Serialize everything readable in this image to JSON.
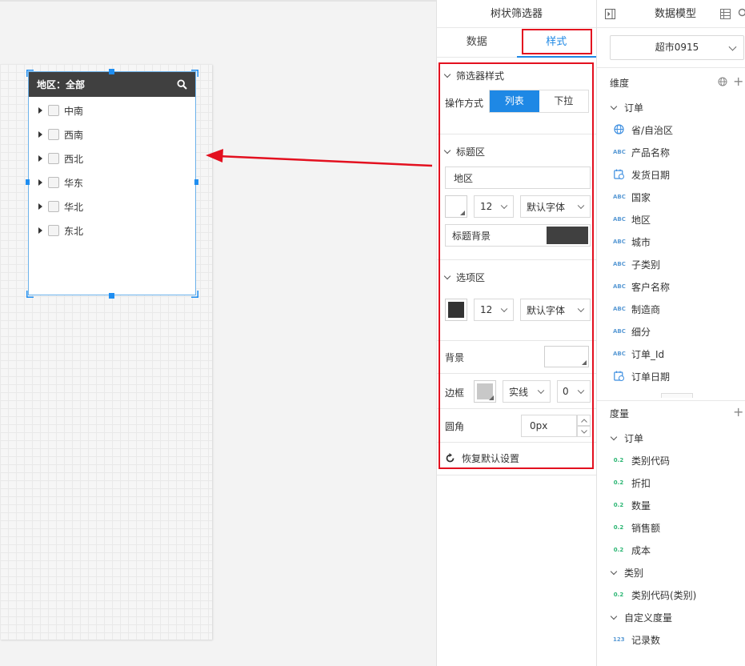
{
  "widget": {
    "title": "地区：全部",
    "items": [
      "中南",
      "西南",
      "西北",
      "华东",
      "华北",
      "东北"
    ]
  },
  "filter_panel": {
    "title": "树状筛选器",
    "tabs": [
      "数据",
      "样式"
    ],
    "active_tab": "样式",
    "section_filter_style": "筛选器样式",
    "operation_label": "操作方式",
    "operation_options": [
      "列表",
      "下拉"
    ],
    "operation_selected": "列表",
    "section_title_area": "标题区",
    "title_text_value": "地区",
    "title_font_size": "12",
    "title_font_family": "默认字体",
    "title_bg_label": "标题背景",
    "title_bg_color": "#404040",
    "section_options_area": "选项区",
    "options_font_color": "#333333",
    "options_font_size": "12",
    "options_font_family": "默认字体",
    "background_label": "背景",
    "background_color": "#ffffff",
    "border_label": "边框",
    "border_color": "#c8c8c8",
    "border_style": "实线",
    "border_width": "0",
    "radius_label": "圆角",
    "radius_value": "0px",
    "reset_label": "恢复默认设置"
  },
  "model_panel": {
    "title": "数据模型",
    "dataset": "超市0915",
    "dimensions_label": "维度",
    "dimension_group": "订单",
    "dimensions": [
      {
        "icon": "globe-icon",
        "label": "省/自治区"
      },
      {
        "icon": "text-icon",
        "label": "产品名称"
      },
      {
        "icon": "calendar-icon",
        "label": "发货日期"
      },
      {
        "icon": "text-icon",
        "label": "国家"
      },
      {
        "icon": "text-icon",
        "label": "地区"
      },
      {
        "icon": "text-icon",
        "label": "城市"
      },
      {
        "icon": "text-icon",
        "label": "子类别"
      },
      {
        "icon": "text-icon",
        "label": "客户名称"
      },
      {
        "icon": "text-icon",
        "label": "制造商"
      },
      {
        "icon": "text-icon",
        "label": "细分"
      },
      {
        "icon": "text-icon",
        "label": "订单_Id"
      },
      {
        "icon": "calendar-icon",
        "label": "订单日期"
      }
    ],
    "measures_label": "度量",
    "measure_groups": [
      {
        "name": "订单",
        "items": [
          "类别代码",
          "折扣",
          "数量",
          "销售额",
          "成本"
        ]
      },
      {
        "name": "类别",
        "items": [
          "类别代码(类别)"
        ]
      },
      {
        "name": "自定义度量",
        "items": [
          "记录数"
        ]
      }
    ],
    "text_icon_glyph": "ABC",
    "decimal_icon_glyph": "0.2",
    "integer_icon_glyph": "123"
  }
}
